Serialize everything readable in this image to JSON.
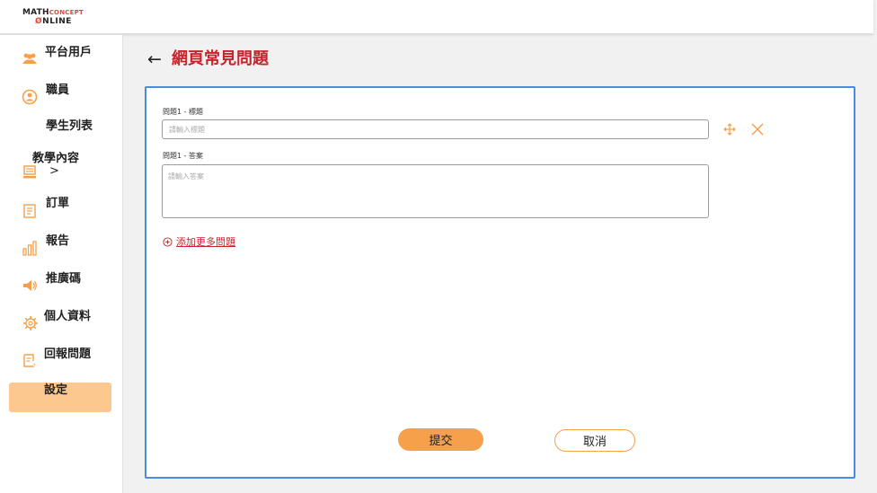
{
  "app": {
    "logo_line1_a": "MATH",
    "logo_line1_b": "CONCEPT",
    "logo_line2_a": "Ø",
    "logo_line2_b": "NLINE"
  },
  "sidebar": {
    "items": [
      {
        "label": "平台用戶",
        "icon": "users-icon"
      },
      {
        "label": "職員",
        "icon": "staff-icon"
      },
      {
        "label": "學生列表",
        "icon": ""
      },
      {
        "label": "教學內容",
        "icon": "teaching-content-icon",
        "chevron": ">"
      },
      {
        "label": "訂單",
        "icon": "orders-icon"
      },
      {
        "label": "報告",
        "icon": "report-chart-icon"
      },
      {
        "label": "推廣碼",
        "icon": "megaphone-icon"
      },
      {
        "label": "個人資料",
        "icon": "gear-icon"
      },
      {
        "label": "回報問題",
        "icon": "feedback-icon"
      },
      {
        "label": "設定",
        "icon": "",
        "active": true
      }
    ]
  },
  "header": {
    "back_arrow": "←",
    "title": "網頁常見問題"
  },
  "form": {
    "question_label": "問題1 - 標題",
    "question_placeholder": "請輸入標題",
    "question_value": "",
    "answer_label": "問題1 - 答案",
    "answer_placeholder": "請輸入答案",
    "answer_value": "",
    "add_more_label": "添加更多問題",
    "submit_label": "提交",
    "cancel_label": "取消"
  },
  "colors": {
    "accent_orange": "#f6a04b",
    "active_nav_bg": "#fcc890",
    "title_red": "#c8232c",
    "panel_border": "#4a8ae0"
  }
}
